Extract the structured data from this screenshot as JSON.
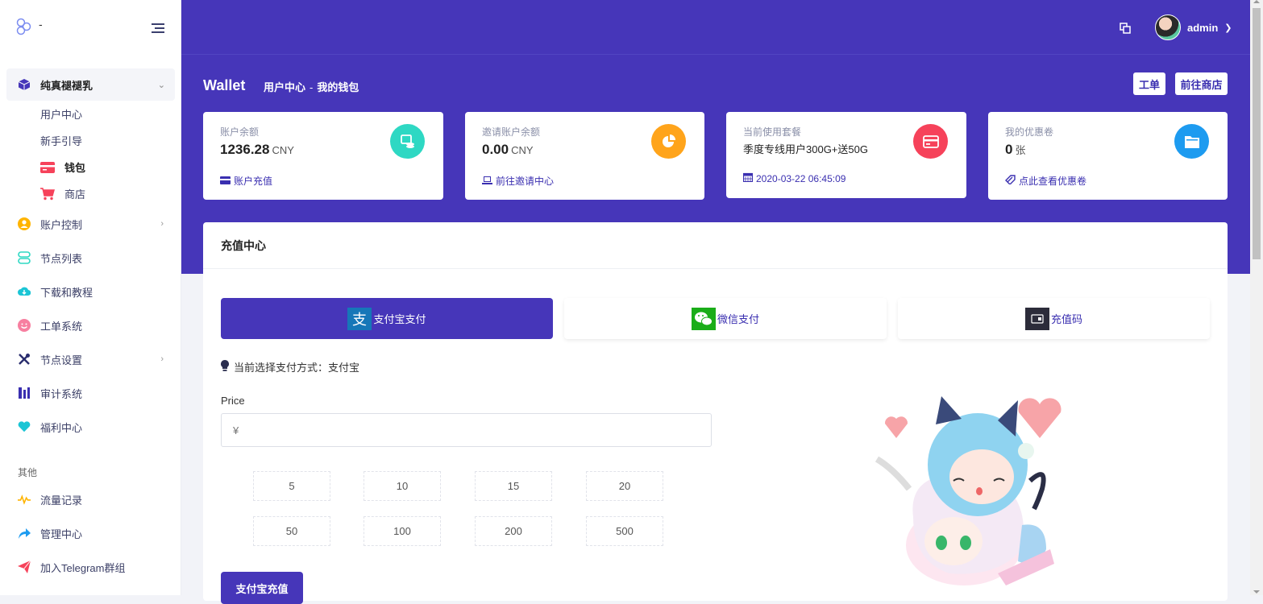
{
  "brand": {
    "name": "-"
  },
  "colors": {
    "primary": "#4636b9",
    "teal": "#2ed8c3",
    "orange": "#ffa41b",
    "red": "#f6425a",
    "blue": "#1d9bf0"
  },
  "user": {
    "name": "admin"
  },
  "sidebar": {
    "group": {
      "label": "纯真褪褪乳",
      "icon": "cube-icon"
    },
    "sub_items": [
      {
        "label": "用户中心"
      },
      {
        "label": "新手引导"
      },
      {
        "label": "钱包",
        "icon": "wallet-card-icon"
      },
      {
        "label": "商店",
        "icon": "cart-icon"
      }
    ],
    "items": [
      {
        "label": "账户控制",
        "icon": "user-circle-icon"
      },
      {
        "label": "节点列表",
        "icon": "nodes-icon"
      },
      {
        "label": "下载和教程",
        "icon": "cloud-download-icon"
      },
      {
        "label": "工单系统",
        "icon": "smile-icon"
      },
      {
        "label": "节点设置",
        "icon": "tools-icon"
      },
      {
        "label": "审计系统",
        "icon": "audit-icon"
      },
      {
        "label": "福利中心",
        "icon": "heart-icon"
      }
    ],
    "section_other": "其他",
    "other_items": [
      {
        "label": "流量记录",
        "icon": "pulse-icon"
      },
      {
        "label": "管理中心",
        "icon": "share-arrow-icon"
      },
      {
        "label": "加入Telegram群组",
        "icon": "paper-plane-icon"
      }
    ]
  },
  "header": {
    "title": "Wallet",
    "breadcrumb_1": "用户中心",
    "breadcrumb_sep": "-",
    "breadcrumb_2": "我的钱包",
    "btn_ticket": "工单",
    "btn_shop": "前往商店"
  },
  "cards": {
    "balance": {
      "label": "账户余额",
      "value": "1236.28",
      "unit": "CNY",
      "link": "账户充值"
    },
    "invite": {
      "label": "邀请账户余额",
      "value": "0.00",
      "unit": "CNY",
      "link": "前往邀请中心"
    },
    "plan": {
      "label": "当前使用套餐",
      "value": "季度专线用户300G+送50G",
      "date": "2020-03-22 06:45:09"
    },
    "coupon": {
      "label": "我的优惠卷",
      "value": "0",
      "unit": "张",
      "link": "点此查看优惠卷"
    }
  },
  "recharge": {
    "title": "充值中心",
    "tabs": [
      {
        "label": "支付宝支付"
      },
      {
        "label": "微信支付"
      },
      {
        "label": "充值码"
      }
    ],
    "hint": "当前选择支付方式：支付宝",
    "price_label": "Price",
    "price_placeholder": "¥",
    "amounts": [
      "5",
      "10",
      "15",
      "20",
      "50",
      "100",
      "200",
      "500"
    ],
    "submit": "支付宝充值"
  }
}
